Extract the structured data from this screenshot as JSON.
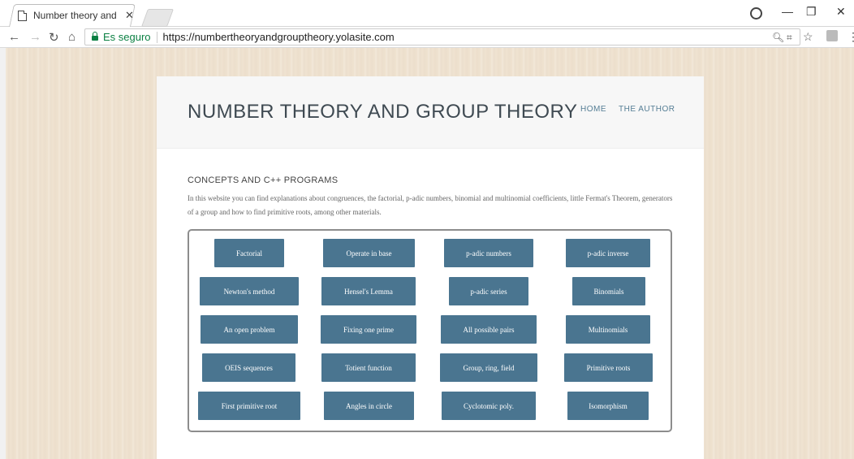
{
  "browser": {
    "tab_title": "Number theory and Grou",
    "secure_label": "Es seguro",
    "url": "https://numbertheoryandgrouptheory.yolasite.com"
  },
  "site": {
    "title": "NUMBER THEORY AND GROUP THEORY",
    "nav": [
      "HOME",
      "THE AUTHOR"
    ]
  },
  "content": {
    "section_title": "CONCEPTS AND C++ PROGRAMS",
    "intro": "In this website you can find explanations about congruences, the factorial, p-adic numbers, binomial and multinomial coefficients, little Fermat's Theorem, generators of a group and how to find primitive roots, among other materials."
  },
  "buttons": [
    [
      "Factorial",
      "Operate in base",
      "p-adic numbers",
      "p-adic inverse"
    ],
    [
      "Newton's method",
      "Hensel's Lemma",
      "p-adic series",
      "Binomials"
    ],
    [
      "An open problem",
      "Fixing one prime",
      "All possible pairs",
      "Multinomials"
    ],
    [
      "OEIS sequences",
      "Totient function",
      "Group, ring, field",
      "Primitive roots"
    ],
    [
      "First primitive root",
      "Angles in circle",
      "Cyclotomic poly.",
      "Isomorphism"
    ]
  ],
  "colors": {
    "button_bg": "#4a7590",
    "nav_link": "#557e95",
    "secure_green": "#0b8043",
    "page_background": "#efe2d0"
  }
}
